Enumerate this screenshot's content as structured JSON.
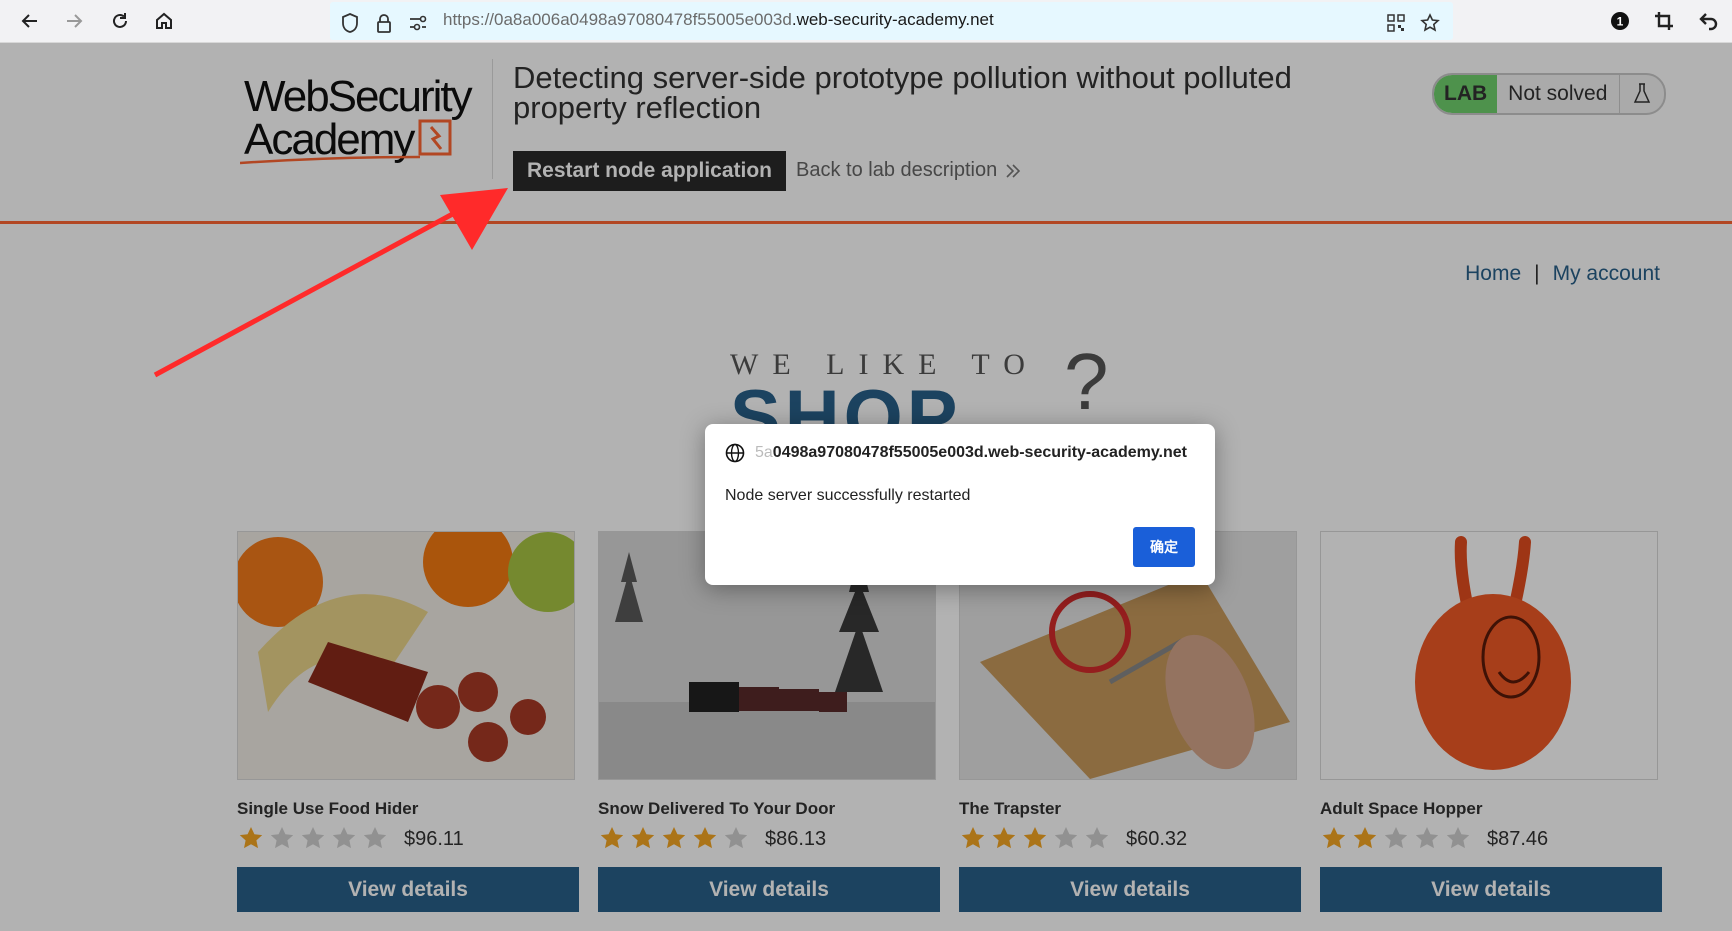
{
  "browser": {
    "url_prefix": "https://0a8a006a0498a97080478f55005e003d",
    "url_domain": ".web-security-academy.net",
    "extension_badge": "1"
  },
  "header": {
    "logo_line1": "WebSecurity",
    "logo_line2": "Academy",
    "lab_title": "Detecting server-side prototype pollution without polluted property reflection",
    "restart_label": "Restart node application",
    "back_label": "Back to lab description",
    "lab_badge": "LAB",
    "lab_status": "Not solved"
  },
  "nav": {
    "home": "Home",
    "separator": "|",
    "account": "My account"
  },
  "hero": {
    "small": "WE LIKE TO",
    "big": "SHOP",
    "mark": "?"
  },
  "products": [
    {
      "name": "Single Use Food Hider",
      "price": "$96.11",
      "rating": 1,
      "button": "View details"
    },
    {
      "name": "Snow Delivered To Your Door",
      "price": "$86.13",
      "rating": 4,
      "button": "View details"
    },
    {
      "name": "The Trapster",
      "price": "$60.32",
      "rating": 3,
      "button": "View details"
    },
    {
      "name": "Adult Space Hopper",
      "price": "$87.46",
      "rating": 2,
      "button": "View details"
    }
  ],
  "dialog": {
    "origin_faded": "5a",
    "origin": "0498a97080478f55005e003d.web-security-academy.net",
    "message": "Node server successfully restarted",
    "ok_label": "确定"
  },
  "colors": {
    "accent_orange": "#ff6633",
    "button_blue": "#29618a",
    "star_gold": "#f5a623",
    "lab_green": "#70d16d",
    "dialog_ok": "#1a5fd9"
  }
}
